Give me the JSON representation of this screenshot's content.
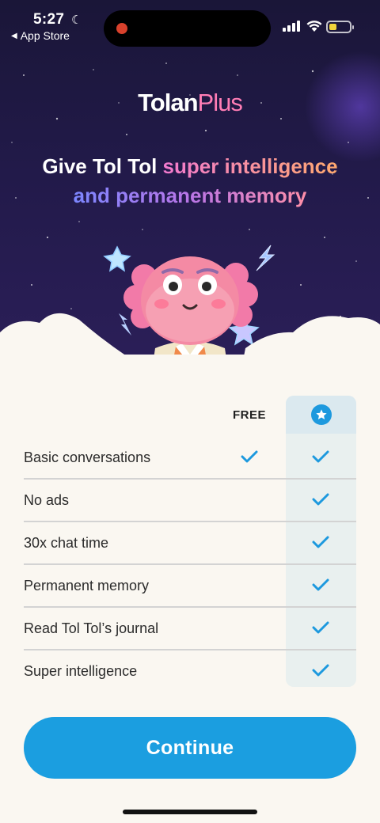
{
  "status_bar": {
    "time": "5:27",
    "back_label": "App Store",
    "battery_color": "#f1d43a"
  },
  "brand": {
    "name_bold": "Tolan",
    "name_plus": "Plus"
  },
  "headline": {
    "line1_plain": "Give Tol Tol ",
    "line1_gradient": "super intelligence",
    "line2_gradient": "and permanent memory"
  },
  "table": {
    "columns": {
      "free": "FREE",
      "plus_icon": "star-icon"
    },
    "rows": [
      {
        "label": "Basic conversations",
        "free": true,
        "plus": true
      },
      {
        "label": "No ads",
        "free": false,
        "plus": true
      },
      {
        "label": "30x chat time",
        "free": false,
        "plus": true
      },
      {
        "label": "Permanent memory",
        "free": false,
        "plus": true
      },
      {
        "label": "Read Tol Tol’s journal",
        "free": false,
        "plus": true
      },
      {
        "label": "Super intelligence",
        "free": false,
        "plus": true
      }
    ]
  },
  "cta": {
    "continue_label": "Continue"
  },
  "colors": {
    "accent": "#1b9ee0",
    "check": "#1d99de",
    "hero_bg": "#221a4a",
    "page_bg": "#faf7f1"
  }
}
